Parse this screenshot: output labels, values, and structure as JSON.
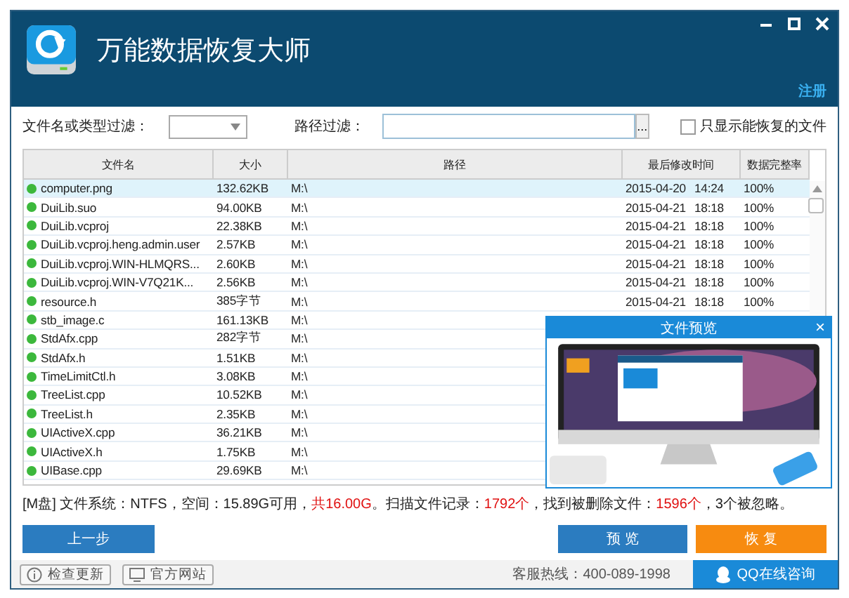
{
  "window": {
    "title": "万能数据恢复大师"
  },
  "register_link": "注册",
  "filters": {
    "name_label": "文件名或类型过滤：",
    "path_label": "路径过滤：",
    "browse": "...",
    "only_recoverable": {
      "label": "只显示能恢复的文件",
      "checked": false
    }
  },
  "table": {
    "columns": [
      "文件名",
      "大小",
      "路径",
      "最后修改时间",
      "数据完整率"
    ],
    "rows": [
      {
        "name": "computer.png",
        "size": "132.62KB",
        "path": "M:\\",
        "date": "2015-04-20",
        "time": "14:24",
        "integrity": "100%",
        "selected": true,
        "color": "#3cb83c"
      },
      {
        "name": "DuiLib.suo",
        "size": "94.00KB",
        "path": "M:\\",
        "date": "2015-04-21",
        "time": "18:18",
        "integrity": "100%",
        "selected": false,
        "color": "#3cb83c"
      },
      {
        "name": "DuiLib.vcproj",
        "size": "22.38KB",
        "path": "M:\\",
        "date": "2015-04-21",
        "time": "18:18",
        "integrity": "100%",
        "selected": false,
        "color": "#3cb83c"
      },
      {
        "name": "DuiLib.vcproj.heng.admin.user",
        "size": "2.57KB",
        "path": "M:\\",
        "date": "2015-04-21",
        "time": "18:18",
        "integrity": "100%",
        "selected": false,
        "color": "#3cb83c"
      },
      {
        "name": "DuiLib.vcproj.WIN-HLMQRS...",
        "size": "2.60KB",
        "path": "M:\\",
        "date": "2015-04-21",
        "time": "18:18",
        "integrity": "100%",
        "selected": false,
        "color": "#3cb83c"
      },
      {
        "name": "DuiLib.vcproj.WIN-V7Q21K...",
        "size": "2.56KB",
        "path": "M:\\",
        "date": "2015-04-21",
        "time": "18:18",
        "integrity": "100%",
        "selected": false,
        "color": "#3cb83c"
      },
      {
        "name": "resource.h",
        "size": "385字节",
        "path": "M:\\",
        "date": "2015-04-21",
        "time": "18:18",
        "integrity": "100%",
        "selected": false,
        "color": "#3cb83c"
      },
      {
        "name": "stb_image.c",
        "size": "161.13KB",
        "path": "M:\\",
        "selected": false,
        "color": "#3cb83c"
      },
      {
        "name": "StdAfx.cpp",
        "size": "282字节",
        "path": "M:\\",
        "selected": false,
        "color": "#3cb83c"
      },
      {
        "name": "StdAfx.h",
        "size": "1.51KB",
        "path": "M:\\",
        "selected": false,
        "color": "#3cb83c"
      },
      {
        "name": "TimeLimitCtl.h",
        "size": "3.08KB",
        "path": "M:\\",
        "selected": false,
        "color": "#3cb83c"
      },
      {
        "name": "TreeList.cpp",
        "size": "10.52KB",
        "path": "M:\\",
        "selected": false,
        "color": "#3cb83c"
      },
      {
        "name": "TreeList.h",
        "size": "2.35KB",
        "path": "M:\\",
        "selected": false,
        "color": "#3cb83c"
      },
      {
        "name": "UIActiveX.cpp",
        "size": "36.21KB",
        "path": "M:\\",
        "selected": false,
        "color": "#3cb83c"
      },
      {
        "name": "UIActiveX.h",
        "size": "1.75KB",
        "path": "M:\\",
        "selected": false,
        "color": "#3cb83c"
      },
      {
        "name": "UIBase.cpp",
        "size": "29.69KB",
        "path": "M:\\",
        "selected": false,
        "color": "#3cb83c"
      }
    ]
  },
  "preview": {
    "title": "文件预览",
    "close": "×"
  },
  "status": [
    {
      "text": "[M盘] 文件系统：NTFS，空间：15.89G可用，",
      "highlight": false
    },
    {
      "text": "共16.00G",
      "highlight": true
    },
    {
      "text": "。扫描文件记录：",
      "highlight": false
    },
    {
      "text": "1792个",
      "highlight": true
    },
    {
      "text": "，找到被删除文件：",
      "highlight": false
    },
    {
      "text": "1596个",
      "highlight": true
    },
    {
      "text": "，3个被忽略。",
      "highlight": false
    }
  ],
  "buttons": {
    "back": "上一步",
    "preview": "预 览",
    "recover": "恢 复"
  },
  "footer": {
    "check_update": "检查更新",
    "website": "官方网站",
    "hotline": "客服热线：400-089-1998",
    "qq": "QQ在线咨询"
  }
}
